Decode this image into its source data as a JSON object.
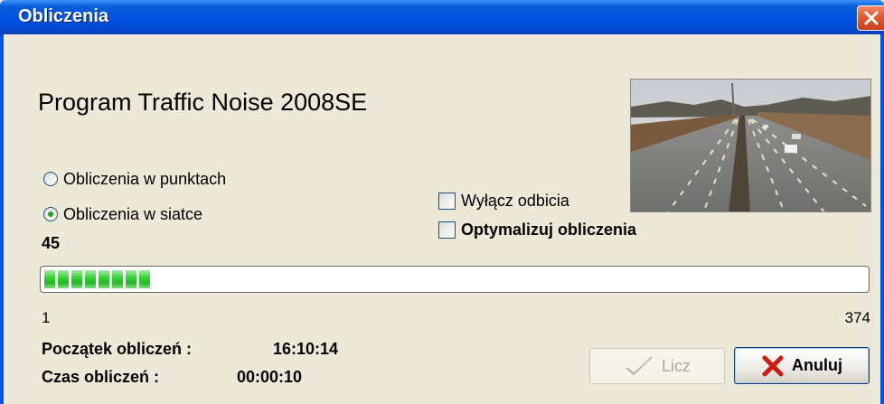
{
  "window": {
    "title": "Obliczenia",
    "close_icon": "close-icon"
  },
  "heading": "Program Traffic Noise 2008SE",
  "photo": {
    "icon": "highway-photo"
  },
  "mode_options": [
    {
      "label": "Obliczenia w punktach",
      "checked": false
    },
    {
      "label": "Obliczenia w siatce",
      "checked": true
    }
  ],
  "options": {
    "disable_reflections": {
      "label": "Wyłącz odbicia",
      "checked": false
    },
    "optimize": {
      "label": "Optymalizuj obliczenia",
      "checked": false
    }
  },
  "progress": {
    "current": "45",
    "min": "1",
    "max": "374",
    "value": 45,
    "range": [
      1,
      374
    ],
    "segments": 8
  },
  "info": {
    "start_label": "Początek obliczeń :",
    "start_value": "16:10:14",
    "elapsed_label": "Czas obliczeń :",
    "elapsed_value": "00:00:10"
  },
  "buttons": {
    "compute": {
      "label": "Licz",
      "enabled": false,
      "icon": "checkmark-icon"
    },
    "cancel": {
      "label": "Anuluj",
      "enabled": true,
      "icon": "red-x-icon"
    }
  },
  "colors": {
    "titlebar": "#0054e3",
    "dialog_bg": "#ece9d8",
    "progress_fill": "#25b825",
    "cancel_x": "#d01c10"
  }
}
